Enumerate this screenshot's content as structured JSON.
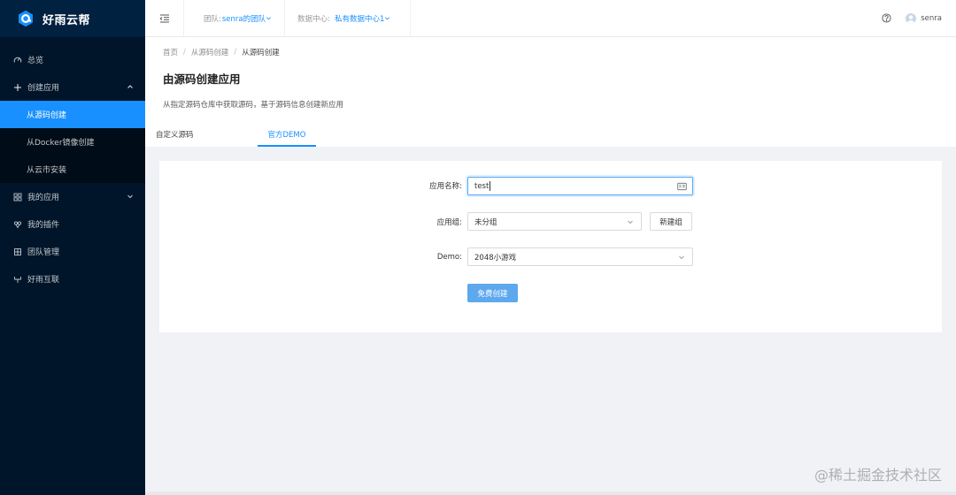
{
  "brand": {
    "name": "好雨云帮",
    "color": "#1890ff"
  },
  "sidebar": {
    "items": [
      {
        "label": "总览",
        "icon": "dashboard-icon"
      },
      {
        "label": "创建应用",
        "icon": "plus-icon",
        "expanded": true
      },
      {
        "label": "从源码创建",
        "active": true
      },
      {
        "label": "从Docker镜像创建"
      },
      {
        "label": "从云市安装"
      },
      {
        "label": "我的应用",
        "icon": "apps-grid-icon"
      },
      {
        "label": "我的插件",
        "icon": "plugin-icon"
      },
      {
        "label": "团队管理",
        "icon": "team-icon"
      },
      {
        "label": "好雨互联",
        "icon": "connect-icon"
      }
    ]
  },
  "header": {
    "team_label": "团队:",
    "team_value": "senra的团队",
    "datacenter_label": "数据中心:",
    "datacenter_value": "私有数据中心1",
    "user_name": "senra"
  },
  "breadcrumb": [
    "首页",
    "从源码创建",
    "从源码创建"
  ],
  "page": {
    "title": "由源码创建应用",
    "description": "从指定源码仓库中获取源码，基于源码信息创建新应用"
  },
  "tabs": [
    {
      "label": "自定义源码",
      "active": false
    },
    {
      "label": "官方DEMO",
      "active": true
    }
  ],
  "form": {
    "app_name_label": "应用名称:",
    "app_name_value": "test",
    "app_group_label": "应用组:",
    "app_group_value": "未分组",
    "new_group_button": "新建组",
    "demo_label": "Demo:",
    "demo_value": "2048小游戏",
    "submit_button": "免费创建"
  },
  "watermark": "@稀土掘金技术社区"
}
